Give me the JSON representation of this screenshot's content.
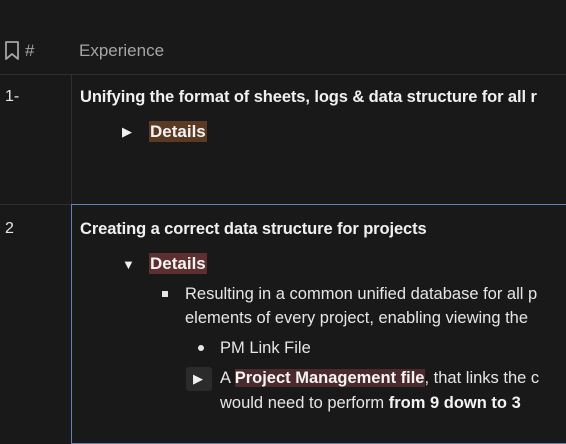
{
  "header": {
    "col_number": "#",
    "col_experience": "Experience"
  },
  "rows": [
    {
      "number": "1-",
      "title": "Unifying the format of sheets, logs & data structure for all r",
      "toggle_label": "Details",
      "expanded": false
    },
    {
      "number": "2",
      "title": "Creating a correct data structure for projects",
      "toggle_label": "Details",
      "expanded": true,
      "bullet_line_1": "Resulting in a common unified database for all p",
      "bullet_line_2": "elements of every project, enabling viewing the",
      "sub_item": "PM Link File",
      "nested_prefix": "A ",
      "nested_highlight": "Project Management file",
      "nested_suffix": ", that links the c",
      "nested_line2_prefix": "would need to perform ",
      "nested_line2_bold": "from 9 down to 3"
    }
  ],
  "colors": {
    "background": "#191919",
    "details_row1_bg": "#5a3a23",
    "details_row2_bg": "#5e2f31",
    "selection_border": "#5d84b4"
  },
  "icons": {
    "header_icon": "bookmark-icon",
    "collapsed_toggle": "triangle-right-icon",
    "expanded_toggle": "triangle-down-icon"
  }
}
